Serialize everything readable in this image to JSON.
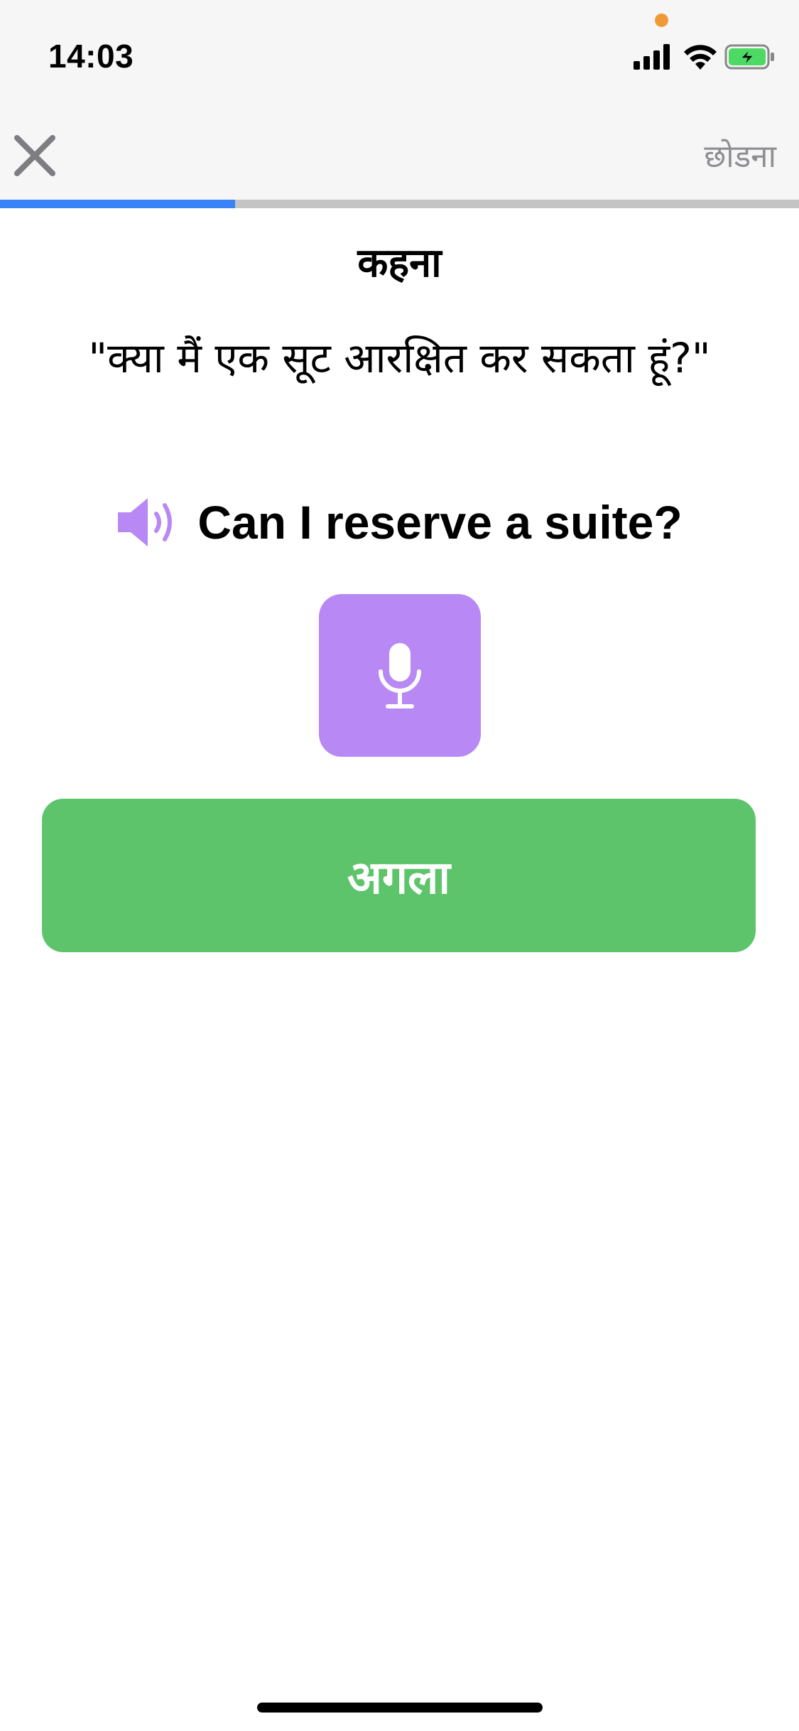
{
  "status_bar": {
    "time": "14:03",
    "icons": [
      "privacy-dot",
      "cellular-signal-icon",
      "wifi-icon",
      "battery-charging-icon"
    ],
    "privacy_dot_color": "#f09a37",
    "battery_color": "#4cd964"
  },
  "nav": {
    "close_icon": "close-icon",
    "skip_label": "छोडना"
  },
  "progress": {
    "fraction": 0.294,
    "fill_color": "#3a82f7",
    "track_color": "#c4c4c4"
  },
  "exercise": {
    "type_label": "कहना",
    "prompt": "\"क्या मैं एक सूट आरक्षित कर सकता हूं?\"",
    "speaker_icon": "speaker-icon",
    "answer": "Can I reserve a suite?",
    "mic_icon": "microphone-icon",
    "accent_color": "#b888f4"
  },
  "actions": {
    "next_label": "अगला",
    "next_color": "#5ec46b"
  }
}
